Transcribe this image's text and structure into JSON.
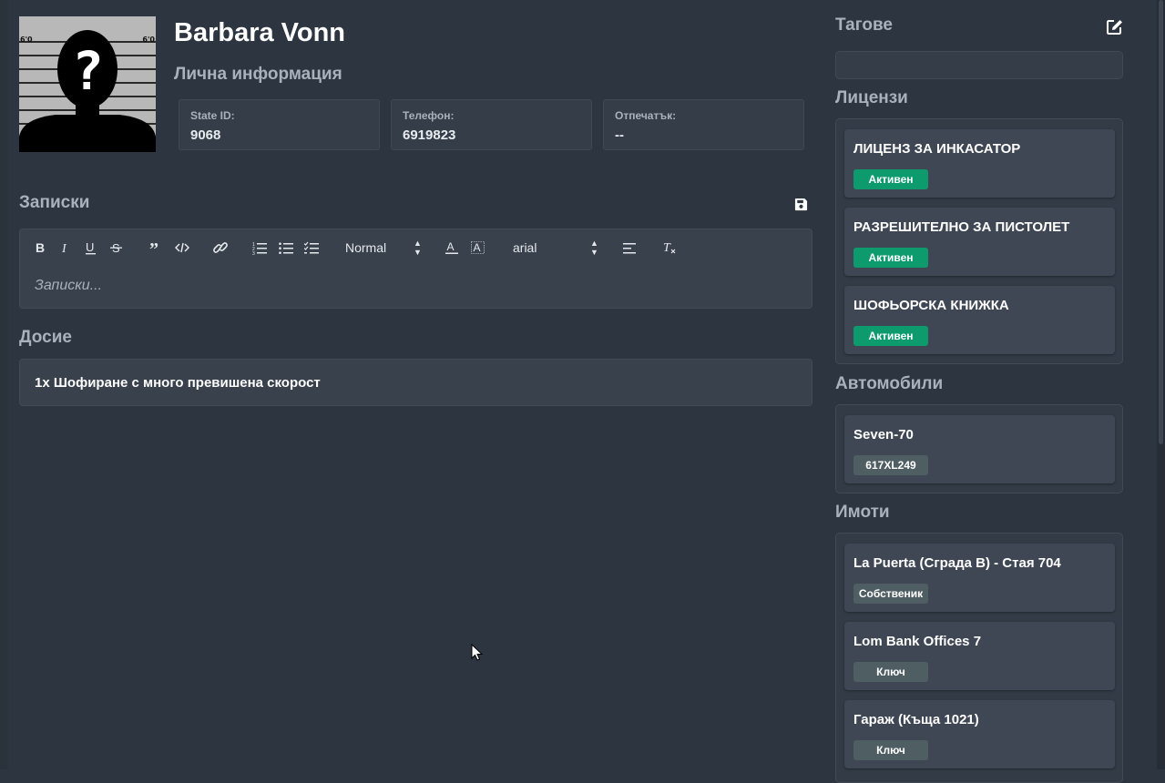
{
  "profile": {
    "name": "Barbara Vonn",
    "subtitle": "Лична информация",
    "mugshot": {
      "height_left": "6'0",
      "height_right": "6'0",
      "mark": "?"
    },
    "fields": [
      {
        "label": "State ID:",
        "value": "9068"
      },
      {
        "label": "Телефон:",
        "value": "6919823"
      },
      {
        "label": "Отпечатък:",
        "value": "--"
      }
    ]
  },
  "notes": {
    "title": "Записки",
    "placeholder": "Записки...",
    "toolbar": {
      "size_select": "Normal",
      "font_select": "arial",
      "icons": [
        "bold-icon",
        "italic-icon",
        "underline-icon",
        "strike-icon",
        "blockquote-icon",
        "code-block-icon",
        "link-icon",
        "ordered-list-icon",
        "bullet-list-icon",
        "check-list-icon",
        "text-color-icon",
        "background-color-icon",
        "align-icon",
        "clear-format-icon"
      ]
    },
    "save_icon": "save-icon"
  },
  "dossier": {
    "title": "Досие",
    "items": [
      "1x Шофиране с много превишена скорост"
    ]
  },
  "tags": {
    "title": "Тагове",
    "edit_icon": "edit-icon"
  },
  "licenses": {
    "title": "Лицензи",
    "items": [
      {
        "name": "ЛИЦЕНЗ ЗА ИНКАСАТОР",
        "status": "Активен"
      },
      {
        "name": "РАЗРЕШИТЕЛНО ЗА ПИСТОЛЕТ",
        "status": "Активен"
      },
      {
        "name": "ШОФЬОРСКА КНИЖКА",
        "status": "Активен"
      }
    ]
  },
  "vehicles": {
    "title": "Автомобили",
    "items": [
      {
        "name": "Seven-70",
        "plate": "617XL249"
      }
    ]
  },
  "properties": {
    "title": "Имоти",
    "items": [
      {
        "name": "La Puerta (Сграда B) - Стая 704",
        "role": "Собственик"
      },
      {
        "name": "Lom Bank Offices 7",
        "role": "Ключ"
      },
      {
        "name": "Гараж (Къща 1021)",
        "role": "Ключ"
      }
    ]
  },
  "colors": {
    "background": "#2c3540",
    "card": "#3e4753",
    "active_badge": "#0d9b6d",
    "neutral_badge": "#4f5e63",
    "muted_text": "#a9b2bc"
  }
}
